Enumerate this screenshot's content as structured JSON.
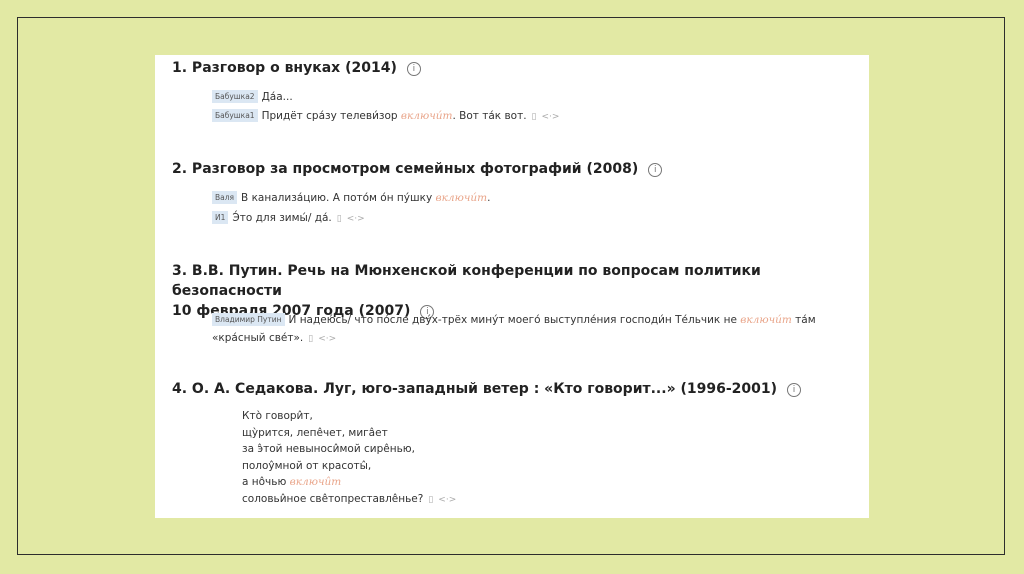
{
  "items": [
    {
      "title": "1. Разговор о внуках (2014)",
      "lines": [
        {
          "speaker": "Бабушка2",
          "text": "Да́а..."
        },
        {
          "speaker": "Бабушка1",
          "text_before": "Придёт сра́зу телеви́зор ",
          "keyword": "включи́т",
          "text_after": ". Вот та́к вот."
        }
      ]
    },
    {
      "title": "2. Разговор за просмотром семейных фотографий (2008)",
      "lines": [
        {
          "speaker": "Валя",
          "text_before": "В канализа́цию. А пото́м о́н пу́шку ",
          "keyword": "включи́т",
          "text_after": "."
        },
        {
          "speaker": "И1",
          "text": "Э́то для зимы́/ да́."
        }
      ]
    },
    {
      "title_line1": "3. В.В. Путин. Речь на Мюнхенской конференции по вопросам политики безопасности",
      "title_line2": "10 февраля 2007 года (2007)",
      "lines": [
        {
          "speaker": "Владимир Путин",
          "text_before": "И  надею́сь/ что по́сле дву́х-трёх мину́т моего́ выступле́ния господи́н Те́льчик не  ",
          "keyword": "включи́т",
          "text_after": " та́м"
        },
        {
          "text": "«кра́сный све́т»."
        }
      ]
    },
    {
      "title": "4. О. А. Седакова. Луг, юго-западный ветер : «Кто говорит...» (1996-2001)",
      "poem": [
        "Кто̀ говори̂т,",
        "щу̀рится, лепе̂чет, мига̂ет",
        "за э̂той невыноси̂мой сире̂нью,",
        "полоу̂мной от красоты̂,",
        "а но̂чью "
      ],
      "poem_keyword": "включи̂т",
      "poem_last": "соловьи̂ное све̂топреставле̂нье?"
    }
  ],
  "icons": {
    "info": "i",
    "copy": "▯",
    "expand": "<·>"
  }
}
